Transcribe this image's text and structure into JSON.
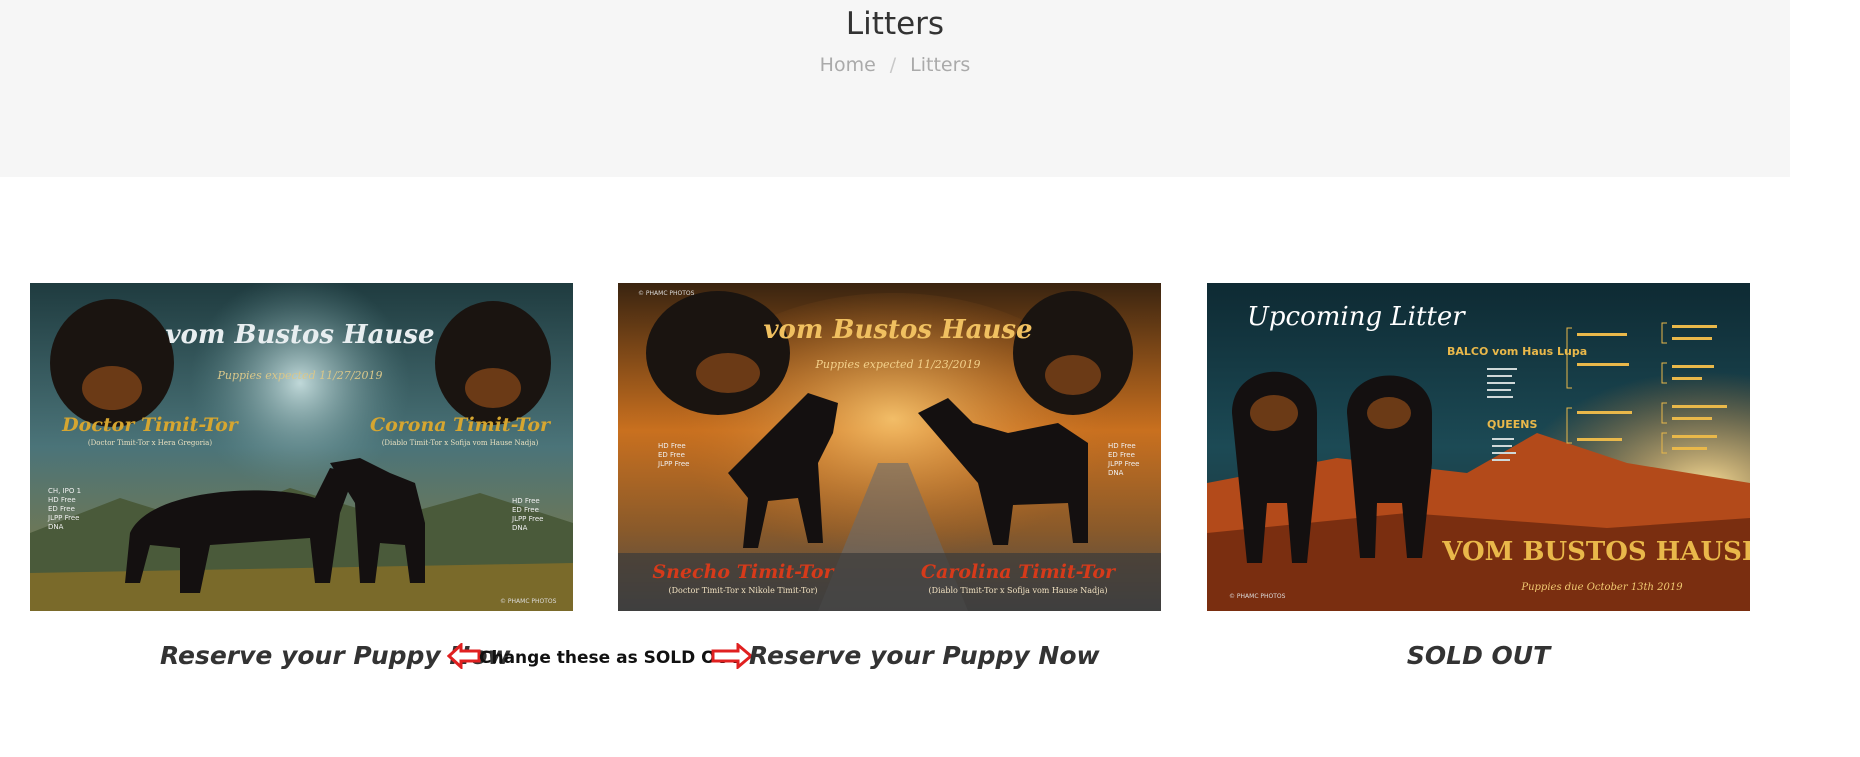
{
  "page": {
    "title": "Litters",
    "breadcrumb": {
      "home": "Home",
      "current": "Litters"
    }
  },
  "litters": [
    {
      "kennel": "vom Bustos Hause",
      "date_text": "Puppies expected 11/27/2019",
      "sire": "Doctor Timit-Tor",
      "sire_parents": "(Doctor Timit-Tor x Hera Gregoria)",
      "dam": "Corona Timit-Tor",
      "dam_parents": "(Diablo Timit-Tor x Sofija vom Hause Nadja)",
      "sire_health": [
        "CH, IPO 1",
        "HD Free",
        "ED Free",
        "JLPP Free",
        "DNA"
      ],
      "dam_health": [
        "HD Free",
        "ED Free",
        "JLPP Free",
        "DNA"
      ],
      "watermark": "© PHAMC PHOTOS",
      "caption": "Reserve your Puppy Now"
    },
    {
      "kennel": "vom Bustos Hause",
      "date_text": "Puppies expected 11/23/2019",
      "sire": "Snecho Timit-Tor",
      "sire_parents": "(Doctor Timit-Tor x Nikole Timit-Tor)",
      "dam": "Carolina Timit-Tor",
      "dam_parents": "(Diablo Timit-Tor x Sofija vom Hause Nadja)",
      "sire_health": [
        "HD Free",
        "ED Free",
        "JLPP Free"
      ],
      "dam_health": [
        "HD Free",
        "ED Free",
        "JLPP Free",
        "DNA"
      ],
      "watermark": "© PHAMC PHOTOS",
      "caption": "Reserve your Puppy Now"
    },
    {
      "heading": "Upcoming Litter",
      "kennel": "VOM BUSTOS HAUSE",
      "date_text": "Puppies due October 13th 2019",
      "sire": "BALCO vom Haus Lupa",
      "dam": "QUEENS",
      "watermark": "© PHAMC PHOTOS",
      "caption": "SOLD OUT"
    }
  ],
  "annotation": {
    "text": "Change these as SOLD OUT",
    "arrow_color": "#e02020"
  },
  "colors": {
    "header_bg": "#f6f6f6",
    "title_text": "#333333",
    "breadcrumb_text": "#aaaaaa",
    "caption_text": "#333333"
  }
}
